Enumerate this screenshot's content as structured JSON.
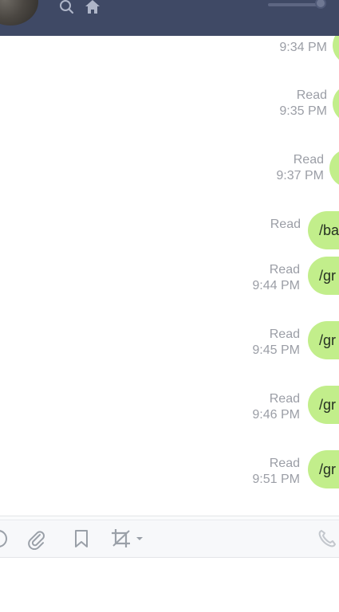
{
  "header": {
    "avatar": "user-avatar",
    "icons": [
      "search-icon",
      "home-icon"
    ],
    "volume_level": 0.92
  },
  "messages": [
    {
      "status": "",
      "time": "9:34 PM",
      "text": ""
    },
    {
      "status": "Read",
      "time": "9:35 PM",
      "text": ""
    },
    {
      "status": "Read",
      "time": "9:37 PM",
      "text": ""
    },
    {
      "status": "Read",
      "time": "",
      "text": "/ba"
    },
    {
      "status": "Read",
      "time": "9:44 PM",
      "text": "/gr"
    },
    {
      "status": "Read",
      "time": "9:45 PM",
      "text": "/gr"
    },
    {
      "status": "Read",
      "time": "9:46 PM",
      "text": "/gr"
    },
    {
      "status": "Read",
      "time": "9:51 PM",
      "text": "/gr"
    }
  ],
  "toolbar": {
    "icons": [
      "emoji-icon",
      "paperclip-icon",
      "bookmark-icon",
      "crop-icon",
      "call-icon"
    ]
  },
  "colors": {
    "header_bg": "#3f4965",
    "bubble_bg": "#c2ee8b",
    "meta_text": "#9b9ea6"
  }
}
